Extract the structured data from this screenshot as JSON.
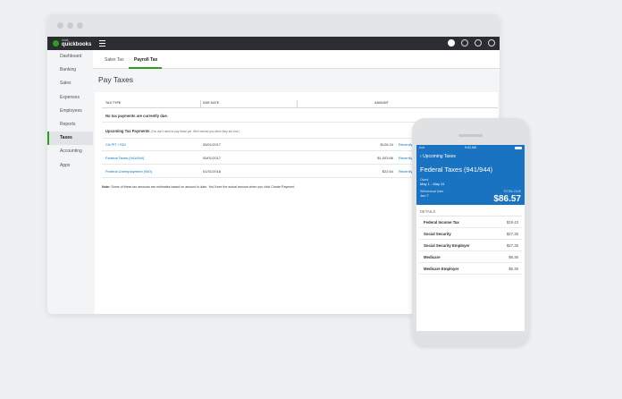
{
  "app": {
    "brand_name": "quickbooks",
    "brand_sub": "intuit",
    "icons": {
      "add": "plus-circle-icon",
      "search": "search-icon",
      "settings": "gear-icon",
      "help": "help-icon",
      "menu": "hamburger-icon"
    },
    "colors": {
      "accent": "#2ca01c",
      "link": "#0077c5",
      "appbar": "#2b2d30",
      "mobile_header": "#1a73c0"
    }
  },
  "sidebar": {
    "items": [
      {
        "label": "Dashboard"
      },
      {
        "label": "Banking"
      },
      {
        "label": "Sales"
      },
      {
        "label": "Expenses"
      },
      {
        "label": "Employees"
      },
      {
        "label": "Reports"
      },
      {
        "label": "Taxes",
        "active": true
      },
      {
        "label": "Accounting"
      },
      {
        "label": "Apps"
      }
    ]
  },
  "tabs": {
    "sales_tax": "Sales Tax",
    "payroll_tax": "Payroll Tax"
  },
  "page": {
    "title": "Pay Taxes"
  },
  "table": {
    "headers": {
      "tax_type": "TAX TYPE",
      "due_date": "DUE DATE",
      "amount": "AMOUNT"
    },
    "no_payments_due": "No tax payments are currently due.",
    "upcoming_title": "Upcoming Tax Payments",
    "upcoming_hint": "(You don't need to pay these yet. We'll remind you when they are due.)",
    "rows": [
      {
        "name": "CA PIT / SDI",
        "due": "05/01/2017",
        "amount": "$126.24",
        "action": "Recently"
      },
      {
        "name": "Federal Taxes (941/944)",
        "due": "05/01/2017",
        "amount": "$1,003.86",
        "action": "Recently"
      },
      {
        "name": "Federal Unemployment (940)",
        "due": "01/31/2018",
        "amount": "$22.64",
        "action": "Recently"
      }
    ],
    "note_label": "Note:",
    "note_text": "Some of these tax amounts are estimates based on amount to date. You'll see the actual amount when you click Create Payment."
  },
  "mobile": {
    "status": {
      "carrier": "•••••",
      "time": "9:41 AM"
    },
    "back_label": "Upcoming Taxes",
    "title": "Federal Taxes (941/944)",
    "owed_label": "Owed",
    "owed_value": "May 1 - May 31",
    "withdrawal_label": "Withdrawal Date",
    "withdrawal_value": "Jun 7",
    "total_label": "TOTAL DUE",
    "total_value": "$86.57",
    "details_label": "DETAILS",
    "items": [
      {
        "name": "Federal Income Tax",
        "value": "$19.43"
      },
      {
        "name": "Social Security",
        "value": "$27.35"
      },
      {
        "name": "Social Security Employer",
        "value": "$27.35"
      },
      {
        "name": "Medicare",
        "value": "$6.36"
      },
      {
        "name": "Medicare Employer",
        "value": "$6.36"
      }
    ]
  }
}
